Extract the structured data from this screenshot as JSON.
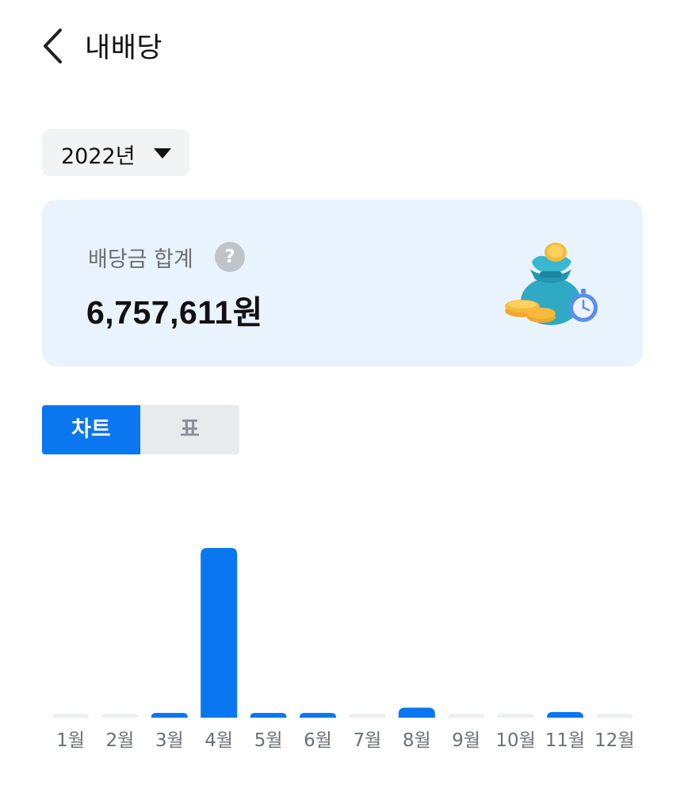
{
  "header": {
    "title": "내배당"
  },
  "year_select": {
    "value": "2022년"
  },
  "summary": {
    "label": "배당금 합계",
    "help": "?",
    "value": "6,757,611원",
    "image_icon": "money-bag-coins-stopwatch-icon"
  },
  "tabs": [
    {
      "label": "차트",
      "selected": true
    },
    {
      "label": "표",
      "selected": false
    }
  ],
  "colors": {
    "accent": "#0a76f0",
    "card_bg": "#e9f3fd",
    "zero_bar": "#eceef1"
  },
  "chart_data": {
    "type": "bar",
    "categories": [
      "1월",
      "2월",
      "3월",
      "4월",
      "5월",
      "6월",
      "7월",
      "8월",
      "9월",
      "10월",
      "11월",
      "12월"
    ],
    "values": [
      0,
      0,
      40000,
      5750000,
      140000,
      60000,
      0,
      340000,
      0,
      0,
      190000,
      0
    ],
    "ylim": [
      0,
      5750000
    ],
    "grid": false,
    "legend": "none"
  }
}
